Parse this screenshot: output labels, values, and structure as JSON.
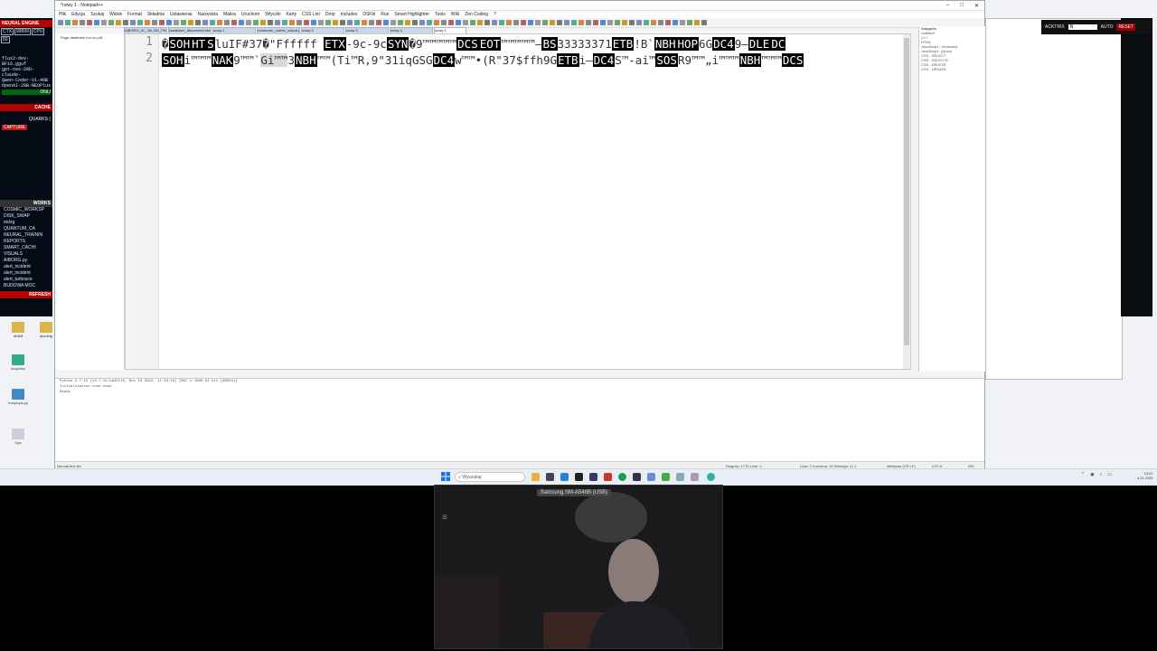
{
  "colors": {
    "control_char_bg": "#000000",
    "panel_bg": "#050b14",
    "alert_red": "#b30000",
    "taskbar": "#e9eef4"
  },
  "left_panel": {
    "title": "NEURAL ENGINE",
    "cells": [
      "CTX",
      "99999",
      "CPU",
      "50"
    ],
    "lines": [
      "flux2-dev-BF16.gguf",
      "gpt-oss-20b-claude-",
      "Qwen-Coder-V1-40B",
      "OpenAI-20B-NEOPlus"
    ],
    "online_label": "ONLI",
    "cache_label": "CACHE",
    "quarks_label": "QUARKS (",
    "capture_label": "CAPTURE",
    "workspace_label": "WORKS",
    "tree": [
      "COSMIC_WORKSP",
      "DISK_SWAP",
      "mdzg",
      "QUANTUM_CA",
      "NEURAL_TRAININ",
      "REPORTS",
      "SMART_CACHI",
      "VISUALS",
      "AIBORG.py",
      "alert_incident",
      "alert_incident",
      "alert_turbosce",
      "BUDOWA MOC"
    ],
    "refresh_label": "REFRESH"
  },
  "editor_window": {
    "title": "*nowy 1 - Notepad++",
    "menu": [
      "Plik",
      "Edycja",
      "Szukaj",
      "Widok",
      "Format",
      "Składnia",
      "Ustawienia",
      "Narzędzia",
      "Makra",
      "Uruchom",
      "Wtyczki",
      "Karty",
      "CSS Lint",
      "Drop",
      "Includes",
      "DSFbl",
      "Run",
      "Smart Highlighter",
      "Tools",
      "Wiki",
      "Zen Coding",
      "?"
    ],
    "tabs": [
      "AIBORG_VL_1B_NO_FNL...",
      "loadtoken_disconnect.html",
      "nowy 1",
      "nvvkerner_cortex_output.py",
      "nowy 2",
      "nowy 3",
      "nowy 4",
      "nowy 1"
    ],
    "active_tab": "nowy 1",
    "left_pane_label": "Page database run no.pdf",
    "line_numbers": [
      "1",
      "2"
    ],
    "code_lines": [
      [
        {
          "t": "�",
          "c": false
        },
        {
          "t": "SOH",
          "c": true
        },
        {
          "t": "HT",
          "c": true
        },
        {
          "t": "S",
          "c": true
        },
        {
          "t": "luIF#37",
          "c": false
        },
        {
          "t": "�",
          "c": false
        },
        {
          "t": "\"Ffffff ",
          "c": false
        },
        {
          "t": "ETX",
          "c": true
        },
        {
          "t": "-9c-9c",
          "c": false
        },
        {
          "t": "SYN",
          "c": true
        },
        {
          "t": "�",
          "c": false
        },
        {
          "t": "9™™™™™",
          "c": false
        },
        {
          "t": "DCS",
          "c": true
        },
        {
          "t": "EOT",
          "c": true
        },
        {
          "t": "™™™™™—",
          "c": false
        },
        {
          "t": "BS",
          "c": true
        },
        {
          "t": "33333371",
          "c": false
        },
        {
          "t": "ETB",
          "c": true
        },
        {
          "t": "!B`",
          "c": false
        },
        {
          "t": "NBH",
          "c": true
        },
        {
          "t": "HOP",
          "c": true
        },
        {
          "t": "6G",
          "c": false
        },
        {
          "t": "DC4",
          "c": true
        },
        {
          "t": "9—",
          "c": false
        },
        {
          "t": "DLE",
          "c": true
        },
        {
          "t": "DC",
          "c": true
        }
      ],
      [
        {
          "t": "SOH",
          "c": true
        },
        {
          "t": "i™™™",
          "c": false
        },
        {
          "t": "NAK",
          "c": true
        },
        {
          "t": "9™™`",
          "c": false
        },
        {
          "t": "Gi™™",
          "c": false,
          "s": true
        },
        {
          "t": "3",
          "c": false
        },
        {
          "t": "NBH",
          "c": true
        },
        {
          "t": "™™(Ti™R,9\"31iqGSG",
          "c": false
        },
        {
          "t": "DC4",
          "c": true
        },
        {
          "t": "w™™•(R\"37$ffh9G",
          "c": false
        },
        {
          "t": "ETB",
          "c": true
        },
        {
          "t": "i—",
          "c": false
        },
        {
          "t": "DC4",
          "c": true
        },
        {
          "t": "S™-ai™",
          "c": false
        },
        {
          "t": "SOS",
          "c": true
        },
        {
          "t": "R9™™„i™™™",
          "c": false
        },
        {
          "t": "NBH",
          "c": true
        },
        {
          "t": "™™™",
          "c": false
        },
        {
          "t": "DCS",
          "c": true
        }
      ]
    ],
    "output": [
      "Python 3.7.15 (v3.7.15:ba25f15, Nov 10 2022, 11:33:16) [MSC v.1900 64 bit (AMD64)]",
      "Initialization code done",
      "Ready"
    ],
    "status": {
      "type": "Normal text file",
      "length": "Długość: 1770   Linie: 2",
      "position": "Linia: 2   Kolumna: 15   Selekcja: 4 | 1",
      "eol": "Windows (CR LF)",
      "encoding": "UTF-8",
      "mode": "INS"
    }
  },
  "right_pane": {
    "title": "Snippets",
    "lines": [
      "Untitled+",
      "",
      "C++",
      "HTML",
      "JavaScript - Generator",
      "JavaScript - jQuery",
      "",
      "CSS - SELECT",
      "CSS - SELECTE",
      "CSS - DELETE",
      "CSS - UPDATE"
    ]
  },
  "acktrix": {
    "name": "ACKTRIX",
    "input": "N",
    "auto": "AUTO",
    "reset": "RESET"
  },
  "desktop_icons": [
    "dfdfdf",
    "abcdefg",
    "noop/hsc",
    "noop/ops.py",
    "Ops"
  ],
  "taskbar": {
    "search_placeholder": "Wyszukaj",
    "time": "13:22",
    "date": "4.11.2025"
  },
  "webcam": {
    "label": "Samsung SM-A546B (USB)"
  }
}
